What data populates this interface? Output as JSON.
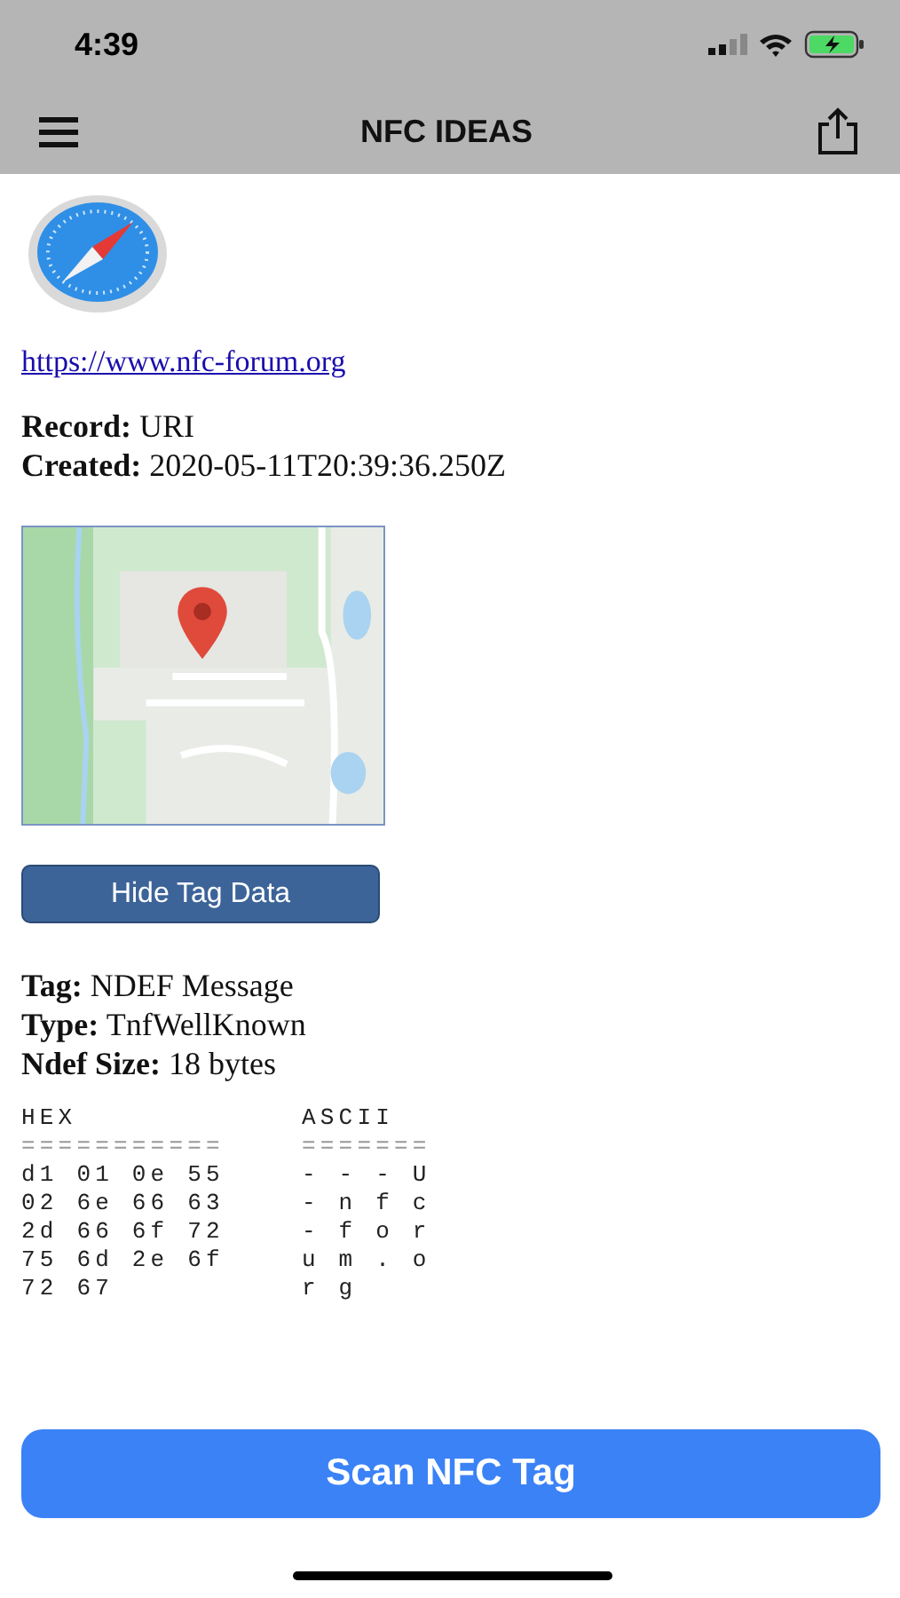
{
  "status_bar": {
    "time": "4:39"
  },
  "nav_bar": {
    "title": "NFC IDEAS"
  },
  "record": {
    "link": "https://www.nfc-forum.org",
    "fields": [
      {
        "label": "Record:",
        "value": "URI"
      },
      {
        "label": "Created:",
        "value": "2020-05-11T20:39:36.250Z"
      }
    ]
  },
  "toggle_button": {
    "label": "Hide Tag Data"
  },
  "tag_fields": [
    {
      "label": "Tag:",
      "value": "NDEF Message"
    },
    {
      "label": "Type:",
      "value": "TnfWellKnown"
    },
    {
      "label": "Ndef Size:",
      "value": "18 bytes"
    }
  ],
  "dump": {
    "headers": [
      "HEX",
      "ASCII"
    ],
    "rules": [
      "===========",
      "======="
    ],
    "rows": [
      {
        "hex": "d1 01 0e 55",
        "ascii": "- - - U"
      },
      {
        "hex": "02 6e 66 63",
        "ascii": "- n f c"
      },
      {
        "hex": "2d 66 6f 72",
        "ascii": "- f o r"
      },
      {
        "hex": "75 6d 2e 6f",
        "ascii": "u m . o"
      },
      {
        "hex": "72 67",
        "ascii": "r g"
      }
    ]
  },
  "scan_button": {
    "label": "Scan NFC Tag"
  }
}
